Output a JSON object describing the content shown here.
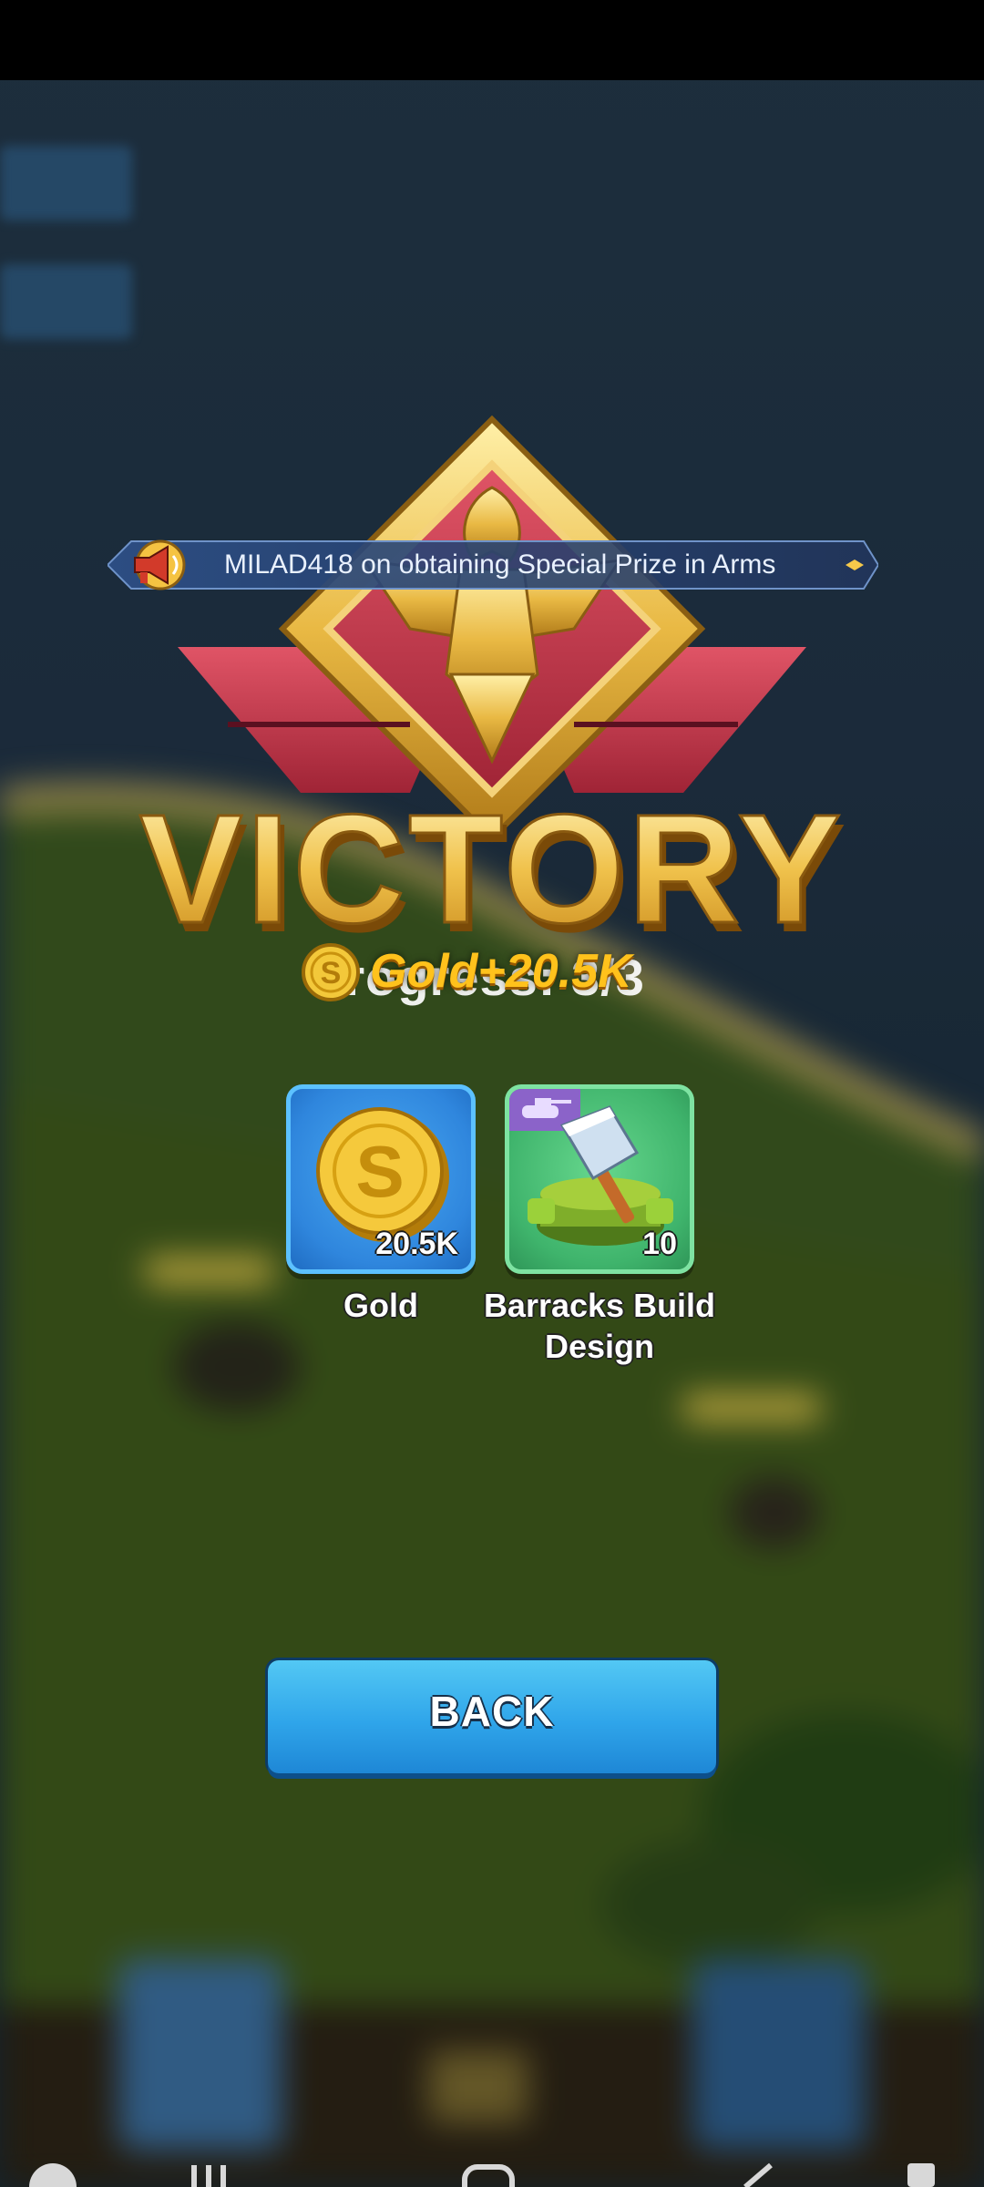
{
  "announcement": {
    "text": "MILAD418 on obtaining Special Prize in Arms"
  },
  "result": {
    "title": "VICTORY",
    "progress_text": "Progress: 3/3",
    "gold_gain_text": "Gold+20.5K"
  },
  "rewards": [
    {
      "name": "Gold",
      "quantity": "20.5K",
      "icon": "gold-coin-icon",
      "tile_color": "#2f86dd"
    },
    {
      "name": "Barracks Build Design",
      "quantity": "10",
      "icon": "barracks-design-icon",
      "tile_color": "#3fb46c"
    }
  ],
  "actions": {
    "back_label": "BACK"
  },
  "colors": {
    "gold": "#ffc21c",
    "victory_red": "#c8364b",
    "button_blue": "#2fa5ea"
  }
}
